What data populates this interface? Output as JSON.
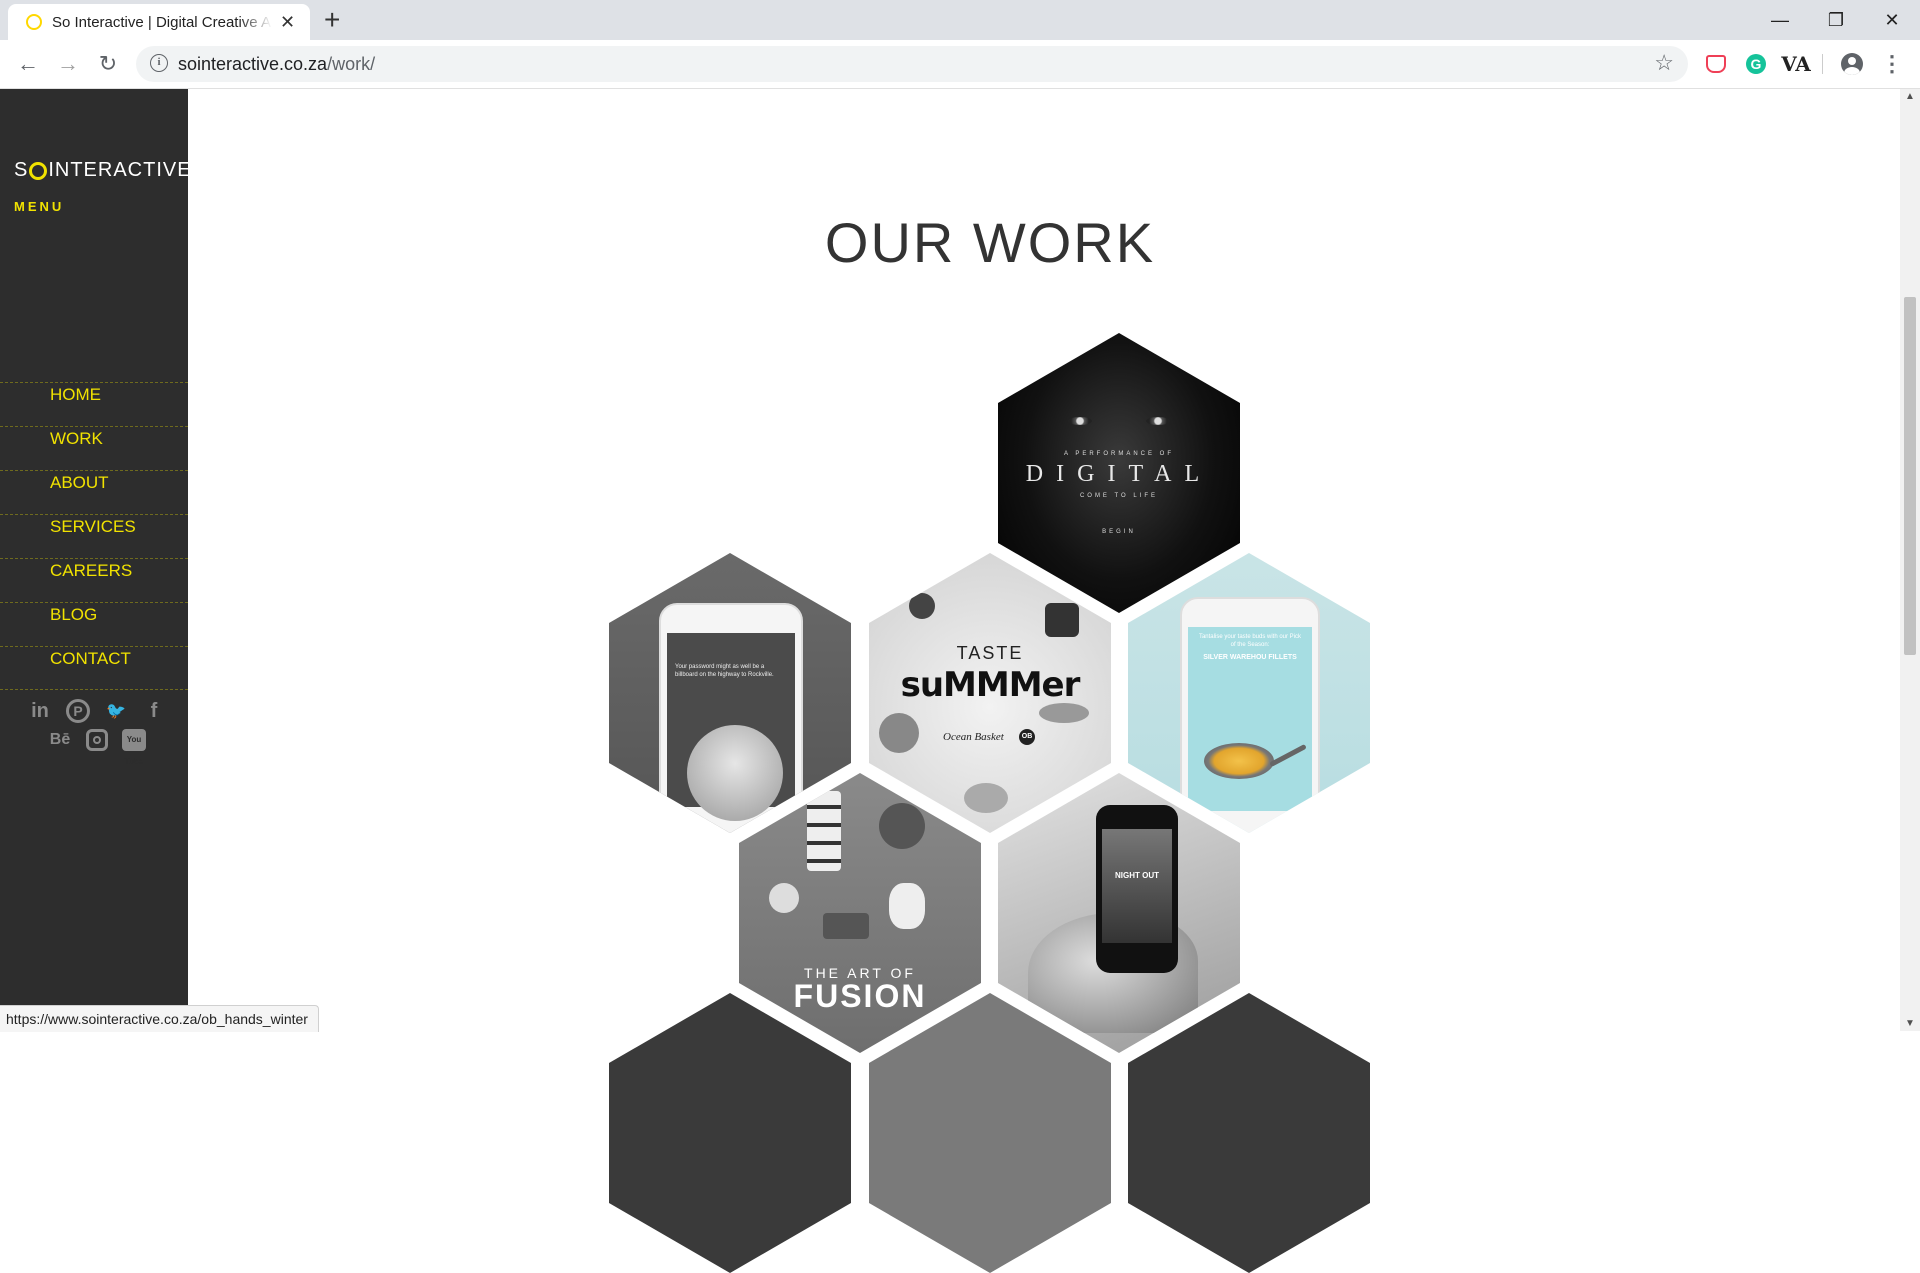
{
  "browser": {
    "tab_title": "So Interactive | Digital Creative A",
    "new_tab": "+",
    "url_domain": "sointeractive.co.za",
    "url_path": "/work/",
    "status_url": "https://www.sointeractive.co.za/ob_hands_winter"
  },
  "sidebar": {
    "logo_left": "S",
    "logo_right": "INTERACTIVE",
    "menu_label": "MENU",
    "nav": [
      "HOME",
      "WORK",
      "ABOUT",
      "SERVICES",
      "CAREERS",
      "BLOG",
      "CONTACT"
    ],
    "social": [
      "linkedin-icon",
      "pinterest-icon",
      "twitter-icon",
      "facebook-icon",
      "behance-icon",
      "instagram-icon",
      "youtube-icon"
    ],
    "social_text": {
      "linkedin": "in",
      "pinterest": "P",
      "twitter": "🐦",
      "facebook": "f",
      "behance": "Bē",
      "youtube": "You Tube"
    }
  },
  "main": {
    "title": "OUR WORK",
    "projects": {
      "digital": {
        "top": "A PERFORMANCE OF",
        "title": "DIGITAL",
        "sub": "COME TO LIFE",
        "cta": "BEGIN"
      },
      "password": {
        "text": "Your password might as well be a billboard on the highway to Rockville."
      },
      "summer": {
        "line1": "TASTE",
        "line2": "suMMMer",
        "brand": "Ocean Basket",
        "badge": "OB"
      },
      "silver": {
        "text": "Tantalise your taste buds with our Pick of the Season:",
        "title": "SILVER WAREHOU FILLETS"
      },
      "fusion": {
        "line1": "THE ART OF",
        "line2": "FUSION"
      },
      "nightout": {
        "text": "NIGHT OUT"
      }
    }
  },
  "colors": {
    "sidebar_bg": "#2d2d2d",
    "accent_yellow": "#f1e200",
    "title_text": "#333333"
  }
}
